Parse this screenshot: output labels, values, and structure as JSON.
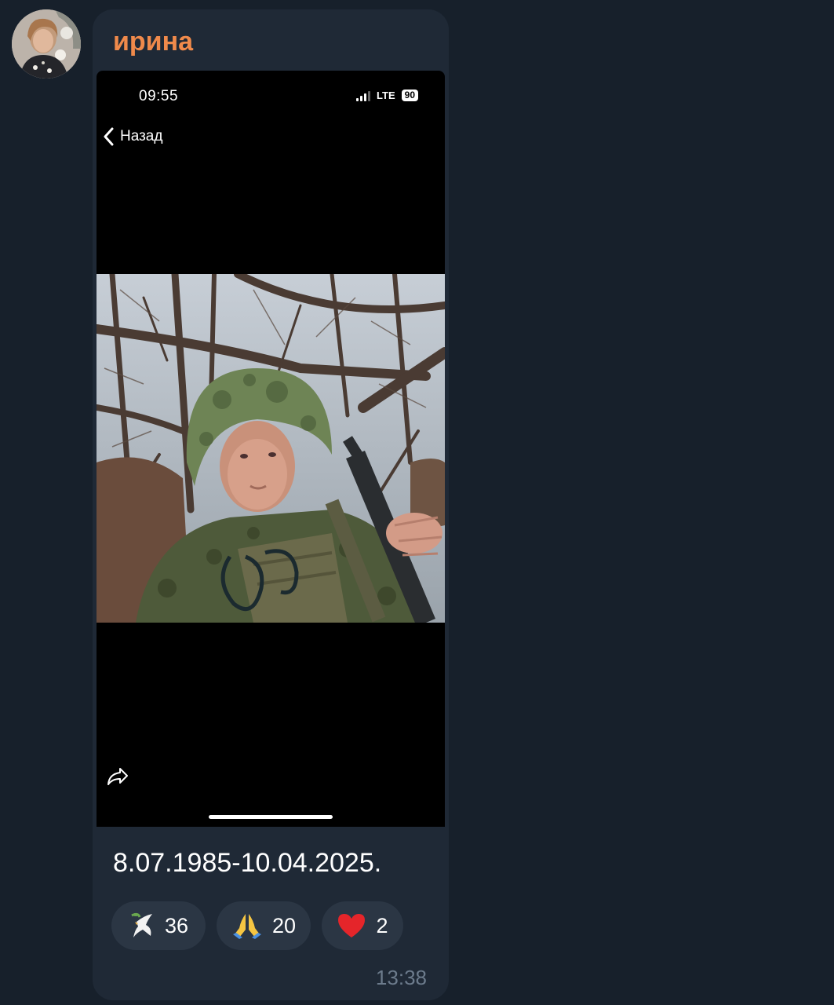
{
  "message": {
    "sender_name": "ирина",
    "caption": "8.07.1985-10.04.2025.",
    "time": "13:38"
  },
  "phone_screenshot": {
    "status_time": "09:55",
    "network": "LTE",
    "battery": "90",
    "back_label": "Назад"
  },
  "reactions": [
    {
      "icon": "dove-icon",
      "count": "36"
    },
    {
      "icon": "praying-hands-icon",
      "count": "20"
    },
    {
      "icon": "heart-icon",
      "count": "2"
    }
  ],
  "colors": {
    "background": "#17202b",
    "bubble": "#1f2936",
    "sender_name": "#f08a4b",
    "reaction_pill": "#2b3644",
    "time": "#6c7b8c"
  }
}
